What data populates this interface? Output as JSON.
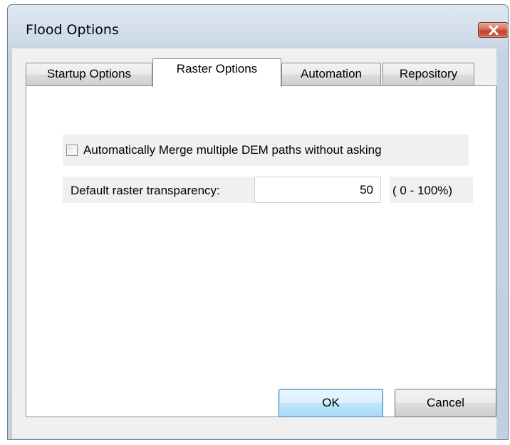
{
  "window": {
    "title": "Flood Options"
  },
  "tabs": [
    {
      "label": "Startup Options",
      "active": false
    },
    {
      "label": "Raster Options",
      "active": true
    },
    {
      "label": "Automation",
      "active": false
    },
    {
      "label": "Repository",
      "active": false
    }
  ],
  "raster_options": {
    "merge_checkbox_label": "Automatically Merge multiple DEM paths without asking",
    "merge_checked": false,
    "transparency_label": "Default raster transparency:",
    "transparency_value": "50",
    "transparency_range": "( 0 - 100%)"
  },
  "buttons": {
    "ok": "OK",
    "cancel": "Cancel"
  },
  "icons": {
    "close": "close-icon"
  },
  "colors": {
    "close_button": "#c4432c",
    "default_button_border": "#3c7fb1"
  }
}
